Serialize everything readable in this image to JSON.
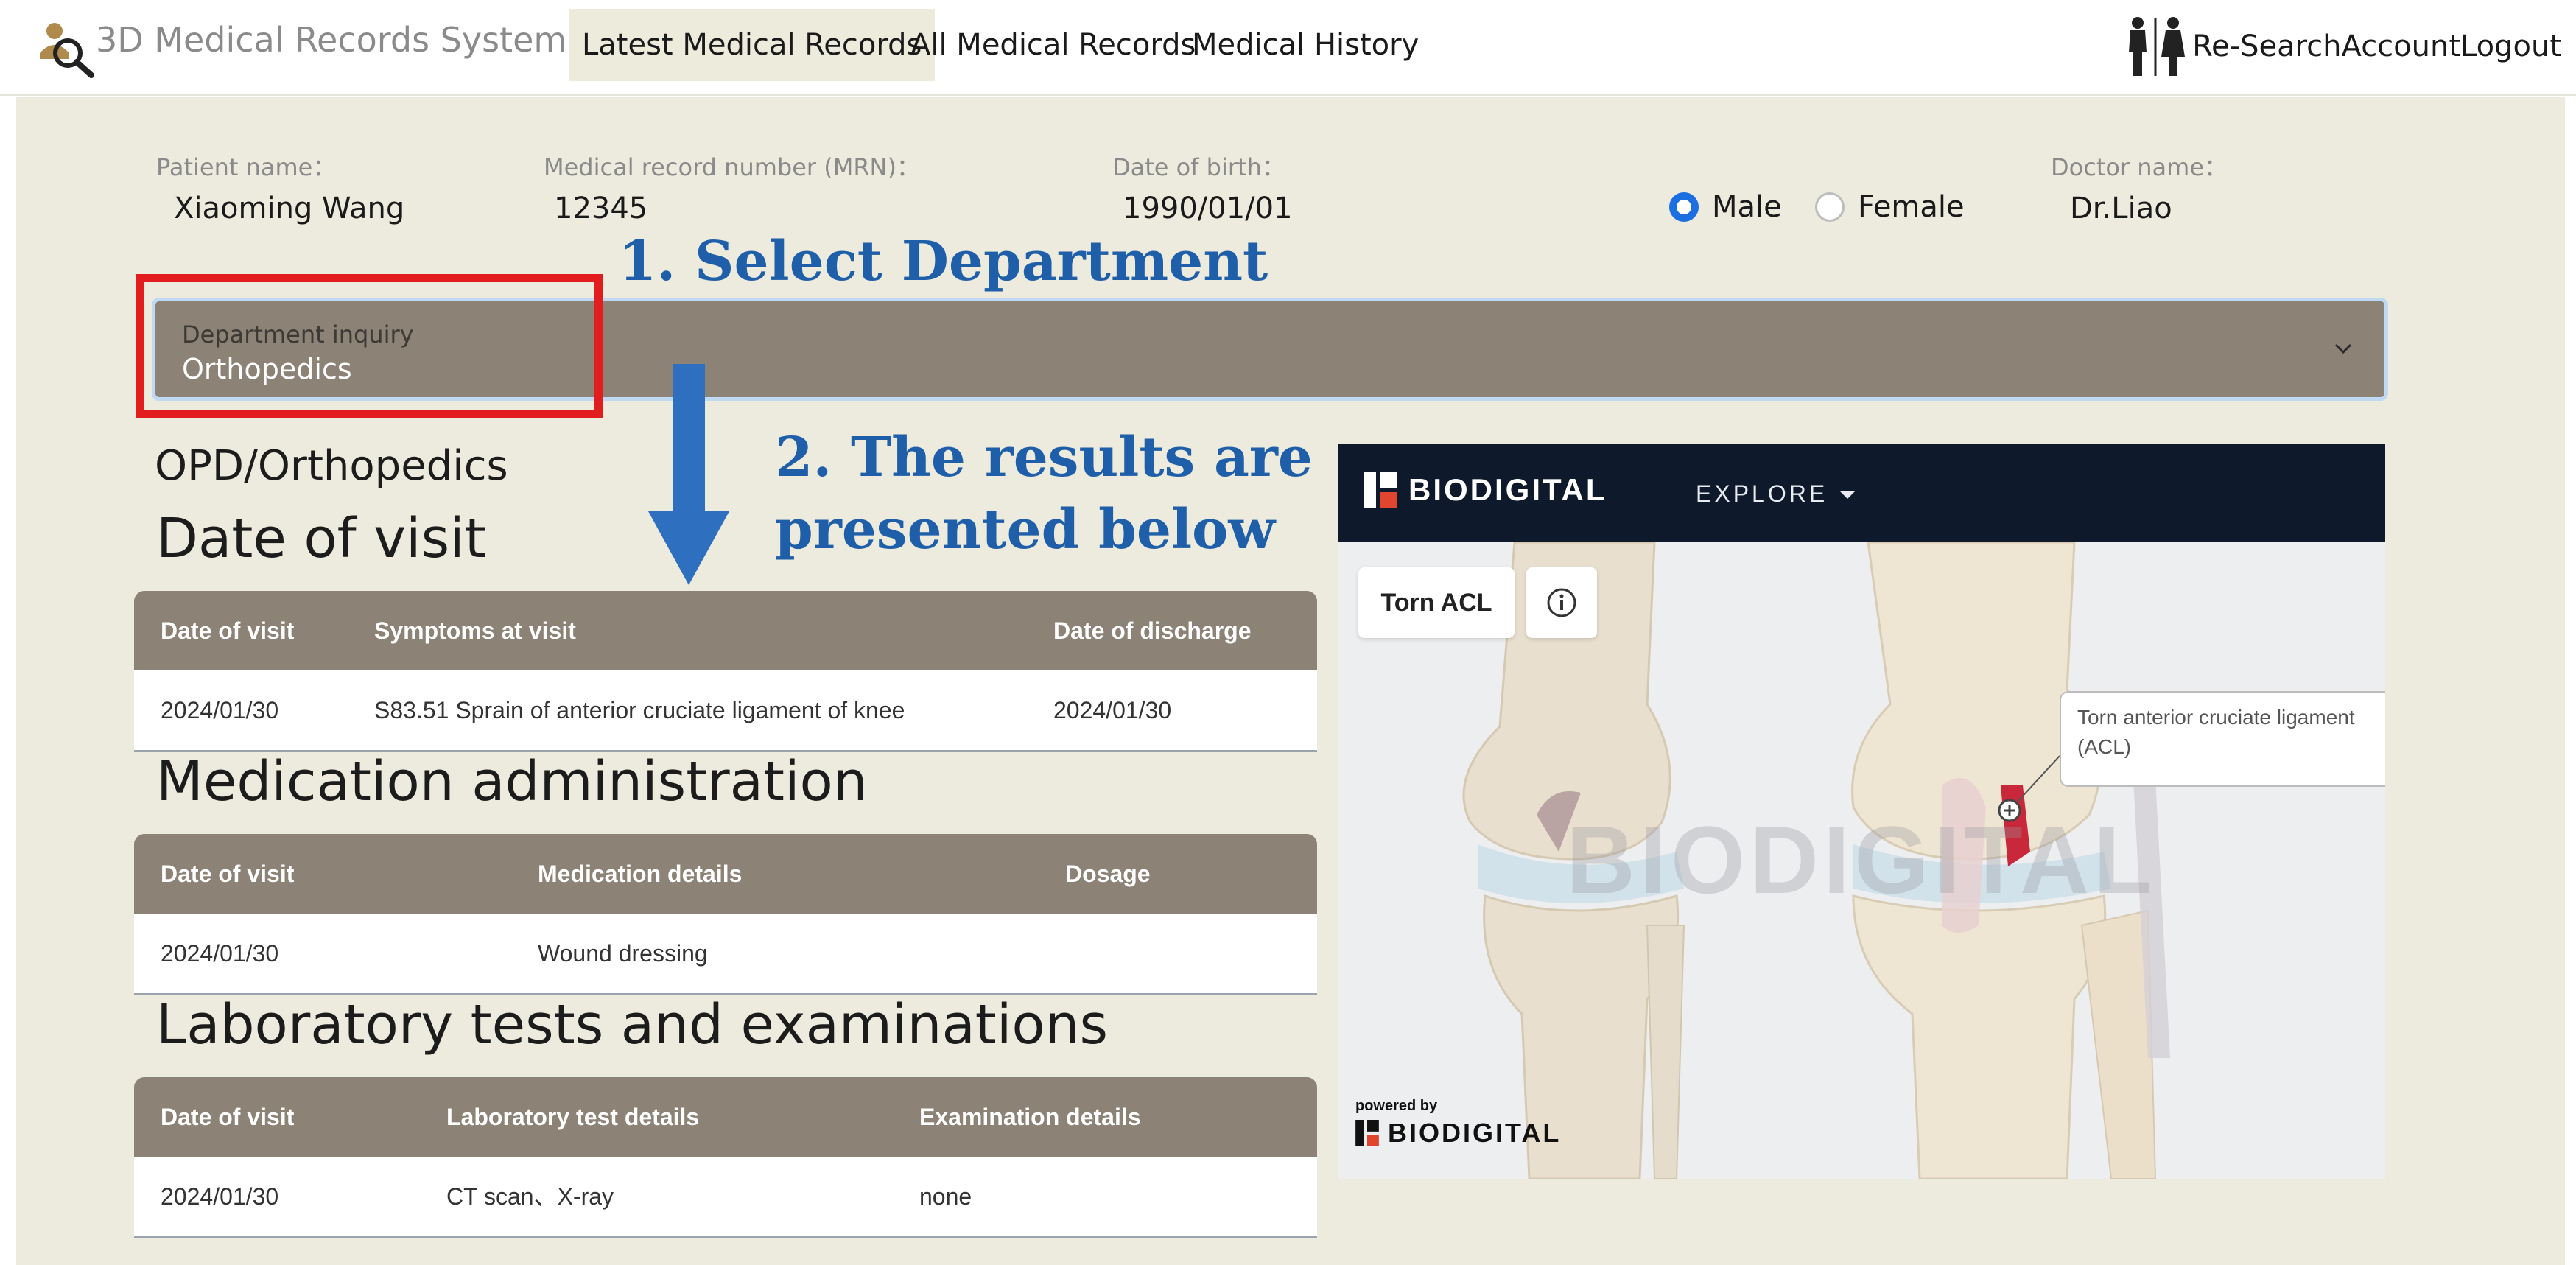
{
  "app": {
    "title": "3D Medical Records System"
  },
  "nav": {
    "tabs": [
      "Latest Medical Records",
      "All Medical Records",
      "Medical History"
    ],
    "right_links": [
      "Re-Search",
      "Account",
      "Logout"
    ]
  },
  "patient": {
    "name_label": "Patient name：",
    "name": "Xiaoming Wang",
    "mrn_label": "Medical record number (MRN)：",
    "mrn": "12345",
    "dob_label": "Date of birth：",
    "dob": "1990/01/01",
    "gender_options": [
      "Male",
      "Female"
    ],
    "gender_selected": "Male",
    "doctor_label": "Doctor name：",
    "doctor": "Dr.Liao"
  },
  "annotations": {
    "step1": "1. Select Department",
    "step2_line1": "2. The results are",
    "step2_line2": "presented below"
  },
  "department": {
    "label": "Department inquiry",
    "value": "Orthopedics"
  },
  "opd_heading": "OPD/Orthopedics",
  "visits": {
    "title": "Date of visit",
    "headers": [
      "Date of visit",
      "Symptoms at visit",
      "Date of discharge"
    ],
    "rows": [
      [
        "2024/01/30",
        "S83.51 Sprain of anterior cruciate ligament of knee",
        "2024/01/30"
      ]
    ]
  },
  "medication": {
    "title": "Medication administration",
    "headers": [
      "Date of visit",
      "Medication details",
      "Dosage"
    ],
    "rows": [
      [
        "2024/01/30",
        "Wound dressing",
        ""
      ]
    ]
  },
  "lab": {
    "title": "Laboratory tests and examinations",
    "headers": [
      "Date of visit",
      "Laboratory test details",
      "Examination details"
    ],
    "rows": [
      [
        "2024/01/30",
        "CT scan、X-ray",
        "none"
      ]
    ]
  },
  "viewer": {
    "brand": "BIODIGITAL",
    "explore": "EXPLORE",
    "model_button": "Torn ACL",
    "callout_line1": "Torn anterior cruciate ligament",
    "callout_line2": "(ACL)",
    "watermark": "BIODIGITAL",
    "powered_by": "powered by"
  },
  "colors": {
    "panel_bg": "#ecebdd",
    "header_bg": "#8c8276",
    "annotation_blue": "#1f5ea8",
    "highlight_red": "#e11d1d",
    "radio_blue": "#1b6fe0"
  }
}
